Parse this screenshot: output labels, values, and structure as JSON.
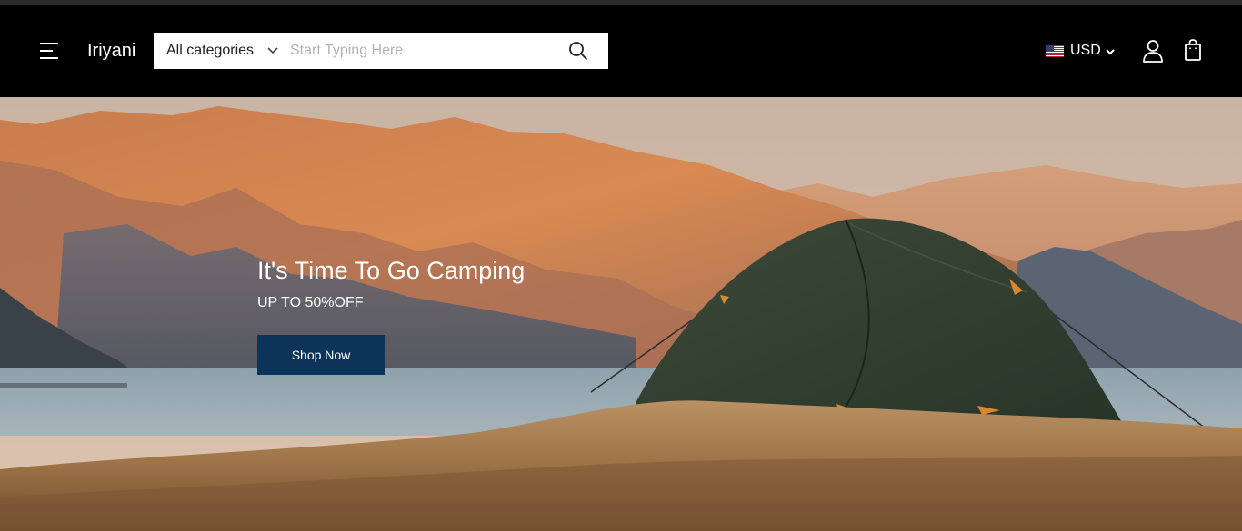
{
  "header": {
    "logo": "Iriyani",
    "search": {
      "category_value": "All categories",
      "placeholder": "Start Typing Here"
    },
    "currency": {
      "label": "USD",
      "flag": "us-flag-icon"
    },
    "icons": [
      "hamburger-menu-icon",
      "chevron-down-icon",
      "search-icon",
      "user-account-icon",
      "shopping-bag-icon"
    ]
  },
  "hero": {
    "title": "It's Time To Go Camping",
    "subtitle": "UP TO 50%OFF",
    "cta_label": "Shop Now"
  },
  "colors": {
    "header_bg": "#000000",
    "cta_bg": "#0c3358",
    "text_light": "#ffffff"
  }
}
